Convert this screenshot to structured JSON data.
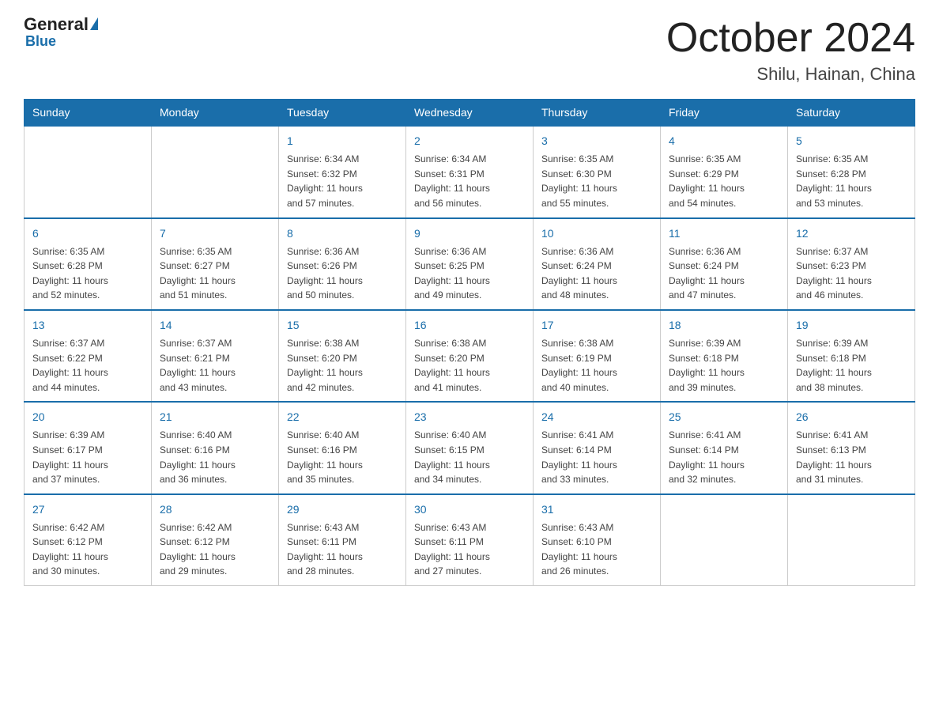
{
  "header": {
    "logo_general": "General",
    "logo_blue": "Blue",
    "title": "October 2024",
    "subtitle": "Shilu, Hainan, China"
  },
  "days_of_week": [
    "Sunday",
    "Monday",
    "Tuesday",
    "Wednesday",
    "Thursday",
    "Friday",
    "Saturday"
  ],
  "weeks": [
    [
      {
        "num": "",
        "info": ""
      },
      {
        "num": "",
        "info": ""
      },
      {
        "num": "1",
        "info": "Sunrise: 6:34 AM\nSunset: 6:32 PM\nDaylight: 11 hours\nand 57 minutes."
      },
      {
        "num": "2",
        "info": "Sunrise: 6:34 AM\nSunset: 6:31 PM\nDaylight: 11 hours\nand 56 minutes."
      },
      {
        "num": "3",
        "info": "Sunrise: 6:35 AM\nSunset: 6:30 PM\nDaylight: 11 hours\nand 55 minutes."
      },
      {
        "num": "4",
        "info": "Sunrise: 6:35 AM\nSunset: 6:29 PM\nDaylight: 11 hours\nand 54 minutes."
      },
      {
        "num": "5",
        "info": "Sunrise: 6:35 AM\nSunset: 6:28 PM\nDaylight: 11 hours\nand 53 minutes."
      }
    ],
    [
      {
        "num": "6",
        "info": "Sunrise: 6:35 AM\nSunset: 6:28 PM\nDaylight: 11 hours\nand 52 minutes."
      },
      {
        "num": "7",
        "info": "Sunrise: 6:35 AM\nSunset: 6:27 PM\nDaylight: 11 hours\nand 51 minutes."
      },
      {
        "num": "8",
        "info": "Sunrise: 6:36 AM\nSunset: 6:26 PM\nDaylight: 11 hours\nand 50 minutes."
      },
      {
        "num": "9",
        "info": "Sunrise: 6:36 AM\nSunset: 6:25 PM\nDaylight: 11 hours\nand 49 minutes."
      },
      {
        "num": "10",
        "info": "Sunrise: 6:36 AM\nSunset: 6:24 PM\nDaylight: 11 hours\nand 48 minutes."
      },
      {
        "num": "11",
        "info": "Sunrise: 6:36 AM\nSunset: 6:24 PM\nDaylight: 11 hours\nand 47 minutes."
      },
      {
        "num": "12",
        "info": "Sunrise: 6:37 AM\nSunset: 6:23 PM\nDaylight: 11 hours\nand 46 minutes."
      }
    ],
    [
      {
        "num": "13",
        "info": "Sunrise: 6:37 AM\nSunset: 6:22 PM\nDaylight: 11 hours\nand 44 minutes."
      },
      {
        "num": "14",
        "info": "Sunrise: 6:37 AM\nSunset: 6:21 PM\nDaylight: 11 hours\nand 43 minutes."
      },
      {
        "num": "15",
        "info": "Sunrise: 6:38 AM\nSunset: 6:20 PM\nDaylight: 11 hours\nand 42 minutes."
      },
      {
        "num": "16",
        "info": "Sunrise: 6:38 AM\nSunset: 6:20 PM\nDaylight: 11 hours\nand 41 minutes."
      },
      {
        "num": "17",
        "info": "Sunrise: 6:38 AM\nSunset: 6:19 PM\nDaylight: 11 hours\nand 40 minutes."
      },
      {
        "num": "18",
        "info": "Sunrise: 6:39 AM\nSunset: 6:18 PM\nDaylight: 11 hours\nand 39 minutes."
      },
      {
        "num": "19",
        "info": "Sunrise: 6:39 AM\nSunset: 6:18 PM\nDaylight: 11 hours\nand 38 minutes."
      }
    ],
    [
      {
        "num": "20",
        "info": "Sunrise: 6:39 AM\nSunset: 6:17 PM\nDaylight: 11 hours\nand 37 minutes."
      },
      {
        "num": "21",
        "info": "Sunrise: 6:40 AM\nSunset: 6:16 PM\nDaylight: 11 hours\nand 36 minutes."
      },
      {
        "num": "22",
        "info": "Sunrise: 6:40 AM\nSunset: 6:16 PM\nDaylight: 11 hours\nand 35 minutes."
      },
      {
        "num": "23",
        "info": "Sunrise: 6:40 AM\nSunset: 6:15 PM\nDaylight: 11 hours\nand 34 minutes."
      },
      {
        "num": "24",
        "info": "Sunrise: 6:41 AM\nSunset: 6:14 PM\nDaylight: 11 hours\nand 33 minutes."
      },
      {
        "num": "25",
        "info": "Sunrise: 6:41 AM\nSunset: 6:14 PM\nDaylight: 11 hours\nand 32 minutes."
      },
      {
        "num": "26",
        "info": "Sunrise: 6:41 AM\nSunset: 6:13 PM\nDaylight: 11 hours\nand 31 minutes."
      }
    ],
    [
      {
        "num": "27",
        "info": "Sunrise: 6:42 AM\nSunset: 6:12 PM\nDaylight: 11 hours\nand 30 minutes."
      },
      {
        "num": "28",
        "info": "Sunrise: 6:42 AM\nSunset: 6:12 PM\nDaylight: 11 hours\nand 29 minutes."
      },
      {
        "num": "29",
        "info": "Sunrise: 6:43 AM\nSunset: 6:11 PM\nDaylight: 11 hours\nand 28 minutes."
      },
      {
        "num": "30",
        "info": "Sunrise: 6:43 AM\nSunset: 6:11 PM\nDaylight: 11 hours\nand 27 minutes."
      },
      {
        "num": "31",
        "info": "Sunrise: 6:43 AM\nSunset: 6:10 PM\nDaylight: 11 hours\nand 26 minutes."
      },
      {
        "num": "",
        "info": ""
      },
      {
        "num": "",
        "info": ""
      }
    ]
  ]
}
